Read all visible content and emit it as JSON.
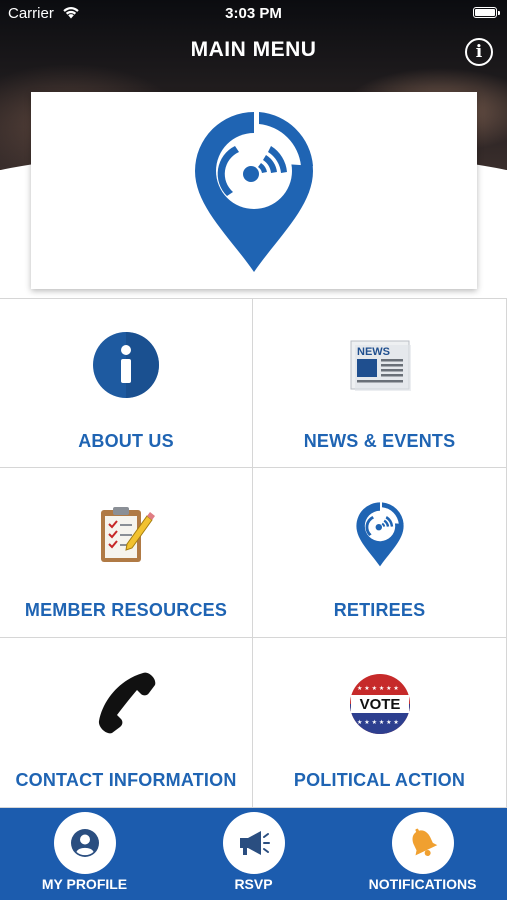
{
  "status_bar": {
    "carrier": "Carrier",
    "time": "3:03 PM"
  },
  "header": {
    "title": "MAIN MENU",
    "info_icon": "info-icon",
    "info_glyph": "i"
  },
  "logo": {
    "icon": "location-pin-signal-icon",
    "color": "#1f64b3"
  },
  "menu": [
    {
      "label": "ABOUT US",
      "icon": "info-circle-icon"
    },
    {
      "label": "NEWS & EVENTS",
      "icon": "newspaper-icon",
      "icon_text": "NEWS"
    },
    {
      "label": "MEMBER RESOURCES",
      "icon": "clipboard-checklist-icon"
    },
    {
      "label": "RETIREES",
      "icon": "location-pin-signal-icon"
    },
    {
      "label": "CONTACT INFORMATION",
      "icon": "phone-icon"
    },
    {
      "label": "POLITICAL ACTION",
      "icon": "vote-button-icon",
      "icon_text": "VOTE"
    }
  ],
  "tabbar": [
    {
      "label": "MY PROFILE",
      "icon": "user-icon"
    },
    {
      "label": "RSVP",
      "icon": "megaphone-icon"
    },
    {
      "label": "NOTIFICATIONS",
      "icon": "bell-icon"
    }
  ],
  "colors": {
    "accent": "#1f64b3",
    "tabbar": "#1c5cae",
    "tab_icon": "#2a4e80",
    "bell": "#f0a030"
  }
}
